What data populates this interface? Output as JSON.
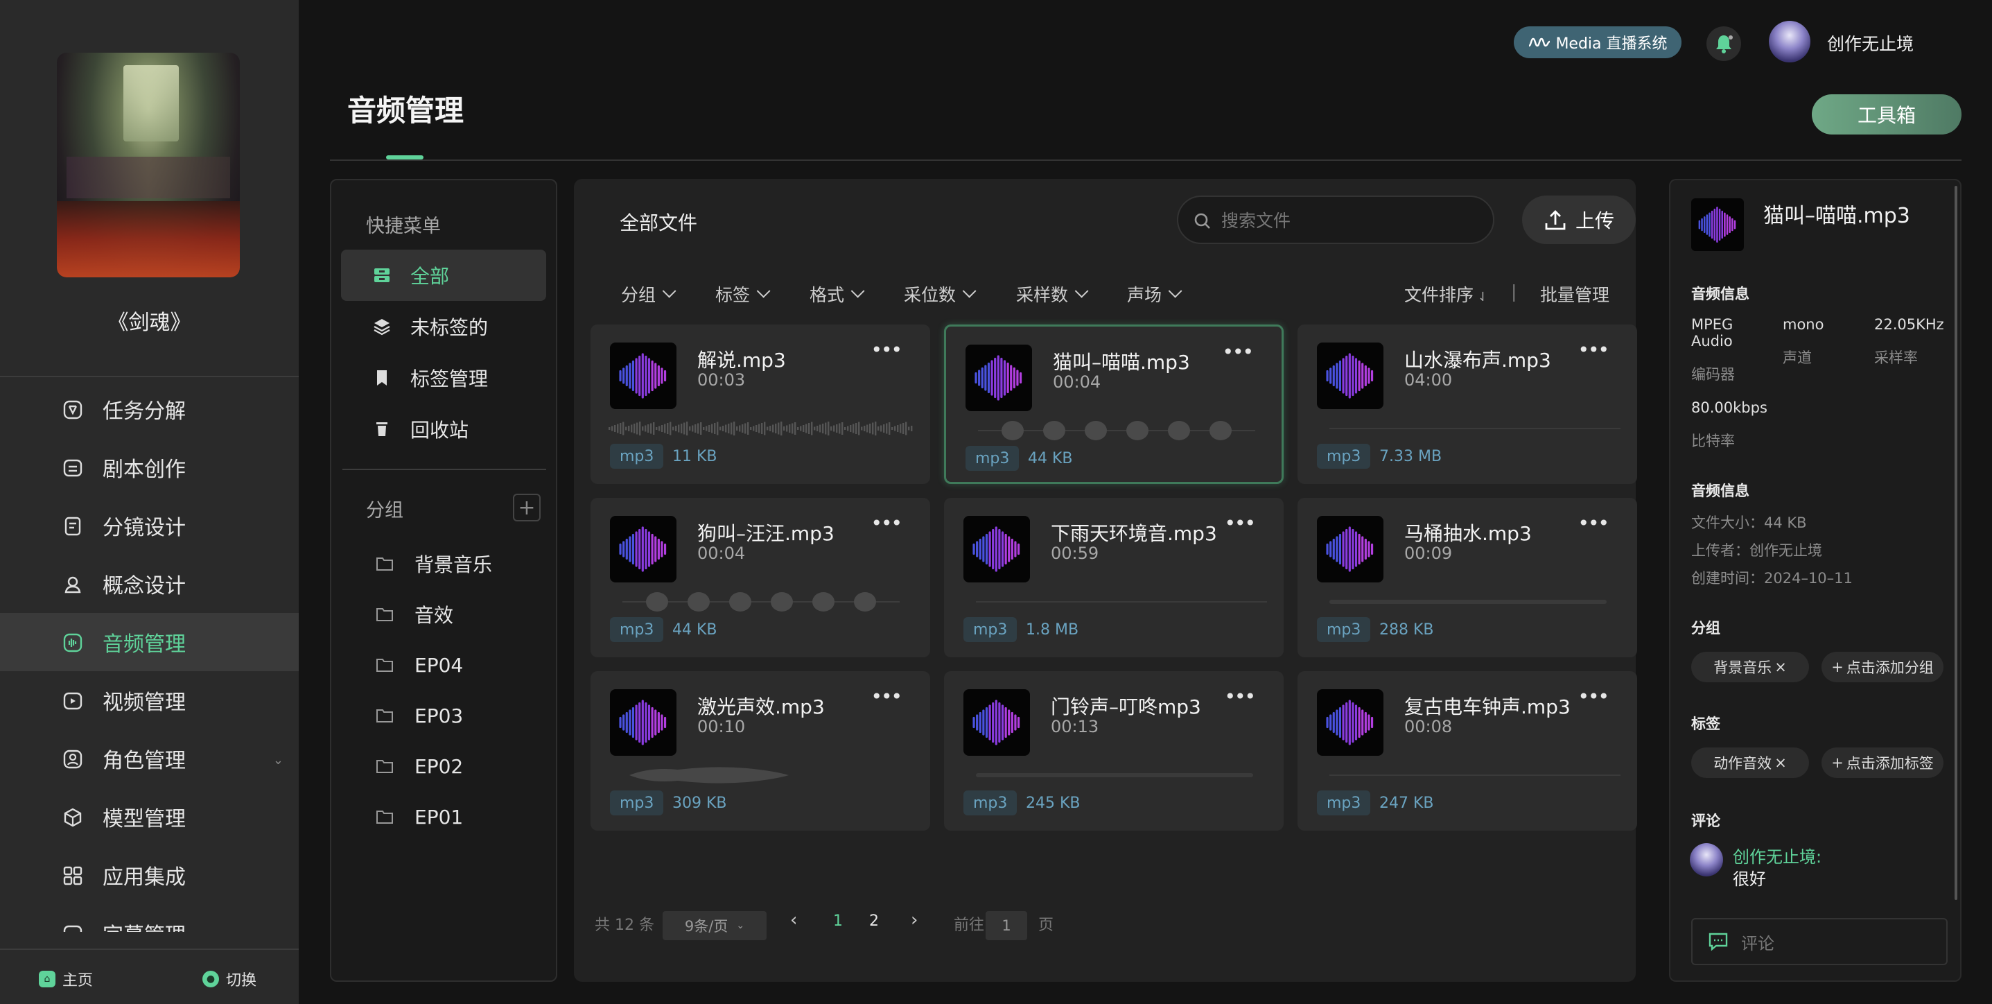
{
  "sidebar": {
    "project_title": "《剑魂》",
    "items": [
      {
        "label": "任务分解",
        "icon": "task-icon"
      },
      {
        "label": "剧本创作",
        "icon": "script-icon"
      },
      {
        "label": "分镜设计",
        "icon": "storyboard-icon"
      },
      {
        "label": "概念设计",
        "icon": "concept-icon"
      },
      {
        "label": "音频管理",
        "icon": "audio-icon",
        "active": true
      },
      {
        "label": "视频管理",
        "icon": "video-icon"
      },
      {
        "label": "角色管理",
        "icon": "character-icon"
      },
      {
        "label": "模型管理",
        "icon": "model-icon"
      },
      {
        "label": "应用集成",
        "icon": "apps-icon"
      },
      {
        "label": "字幕管理",
        "icon": "subtitle-icon"
      }
    ],
    "bottom": {
      "home_label": "主页",
      "switch_label": "切换"
    }
  },
  "header": {
    "badge_label": "Media 直播系统",
    "username": "创作无止境",
    "page_title": "音频管理",
    "toolbox_label": "工具箱"
  },
  "quick_menu": {
    "title": "快捷菜单",
    "items": [
      {
        "label": "全部",
        "active": true
      },
      {
        "label": "未标签的"
      },
      {
        "label": "标签管理"
      },
      {
        "label": "回收站"
      }
    ],
    "group_title": "分组",
    "groups": [
      "背景音乐",
      "音效",
      "EP04",
      "EP03",
      "EP02",
      "EP01"
    ]
  },
  "files": {
    "title": "全部文件",
    "search_placeholder": "搜索文件",
    "upload_label": "上传",
    "filters": [
      "分组",
      "标签",
      "格式",
      "采位数",
      "采样数",
      "声场"
    ],
    "sort_label": "文件排序",
    "batch_label": "批量管理",
    "cards": [
      {
        "name": "解说.mp3",
        "duration": "00:03",
        "format": "mp3",
        "size": "11 KB",
        "wave": "speech"
      },
      {
        "name": "猫叫–喵喵.mp3",
        "duration": "00:04",
        "format": "mp3",
        "size": "44 KB",
        "wave": "blobs",
        "selected": true
      },
      {
        "name": "山水瀑布声.mp3",
        "duration": "04:00",
        "format": "mp3",
        "size": "7.33 MB",
        "wave": "flat"
      },
      {
        "name": "狗叫–汪汪.mp3",
        "duration": "00:04",
        "format": "mp3",
        "size": "44 KB",
        "wave": "blobs"
      },
      {
        "name": "下雨天环境音.mp3",
        "duration": "00:59",
        "format": "mp3",
        "size": "1.8 MB",
        "wave": "flat"
      },
      {
        "name": "马桶抽水.mp3",
        "duration": "00:09",
        "format": "mp3",
        "size": "288 KB",
        "wave": "low"
      },
      {
        "name": "激光声效.mp3",
        "duration": "00:10",
        "format": "mp3",
        "size": "309 KB",
        "wave": "cloud"
      },
      {
        "name": "门铃声–叮咚mp3",
        "duration": "00:13",
        "format": "mp3",
        "size": "245 KB",
        "wave": "low"
      },
      {
        "name": "复古电车钟声.mp3",
        "duration": "00:08",
        "format": "mp3",
        "size": "247 KB",
        "wave": "flat"
      }
    ],
    "pagination": {
      "total": "共 12 条",
      "per_page": "9条/页",
      "pages": [
        "1",
        "2"
      ],
      "current_page": 1,
      "goto_label": "前往",
      "goto_value": "1",
      "page_suffix": "页"
    }
  },
  "details": {
    "file_name": "猫叫–喵喵.mp3",
    "audio_info_title": "音频信息",
    "codec_value": "MPEG Audio",
    "codec_label": "编码器",
    "channel_value": "mono",
    "channel_label": "声道",
    "samplerate_value": "22.05KHz",
    "samplerate_label": "采样率",
    "bitrate_value": "80.00kbps",
    "bitrate_label": "比特率",
    "file_info_title": "音频信息",
    "file_size": "文件大小：44 KB",
    "uploader": "上传者：创作无止境",
    "created": "创建时间：2024–10–11",
    "group_title": "分组",
    "group_chip": "背景音乐",
    "add_group": "点击添加分组",
    "tag_title": "标签",
    "tag_chip": "动作音效",
    "add_tag": "点击添加标签",
    "comment_title": "评论",
    "comment_user": "创作无止境:",
    "comment_text": "很好",
    "comment_placeholder": "评论"
  },
  "colors": {
    "accent": "#5fd39a",
    "sidebar_bg": "#2a2a2a",
    "page_bg": "#141414",
    "card_bg": "#2c2c2c",
    "tag_text": "#6aa3c0"
  }
}
